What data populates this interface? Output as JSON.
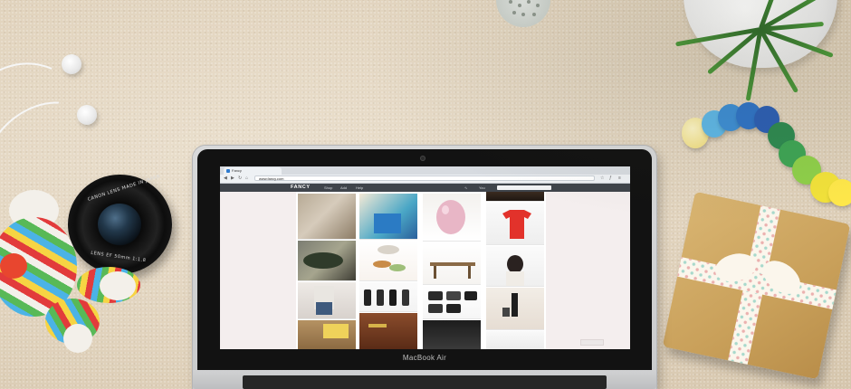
{
  "scene": {
    "description_hidden": "",
    "background_color": "#e4d7c2"
  },
  "laptop": {
    "brand_label": "MacBook Air",
    "browser": {
      "tab_title": "Fancy",
      "url": "www.fancy.com",
      "nav_glyphs": [
        "◀",
        "▶",
        "↻",
        "⌂"
      ]
    },
    "site": {
      "logo": "FANCY",
      "nav": [
        "Shop",
        "Add",
        "Help"
      ],
      "you_label": "You",
      "search_placeholder": "",
      "corner_button": ""
    }
  },
  "lens": {
    "text_top": "CANON LENS MADE IN JAPAN",
    "text_bottom": "LENS EF 50mm 1:1.8"
  },
  "colors": {
    "accent": "#3f444b",
    "carpet": "#e4d7c2",
    "gift_paper": "#d2ab67",
    "ribbon": "#fbf6ec"
  }
}
